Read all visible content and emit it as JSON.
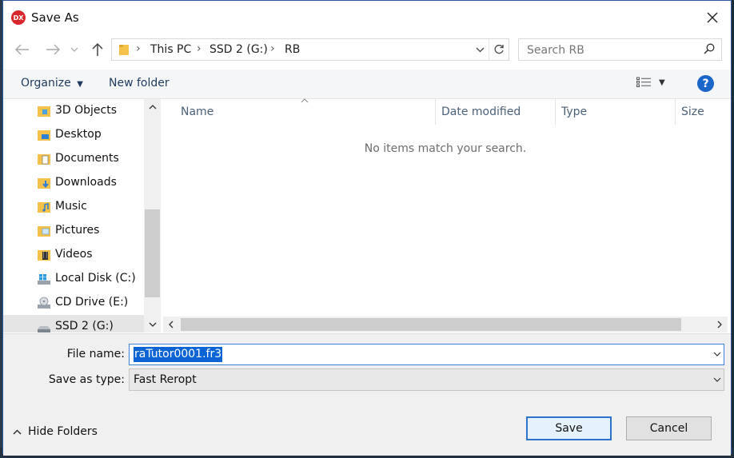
{
  "window": {
    "title": "Save As",
    "app_icon_text": "DX"
  },
  "address": {
    "crumbs": [
      "This PC",
      "SSD 2 (G:)",
      "RB"
    ]
  },
  "search": {
    "placeholder": "Search RB"
  },
  "toolbar": {
    "organize_label": "Organize",
    "new_folder_label": "New folder",
    "help_label": "?"
  },
  "nav_items": [
    {
      "label": "3D Objects",
      "icon": "3d-objects-folder-icon"
    },
    {
      "label": "Desktop",
      "icon": "desktop-folder-icon"
    },
    {
      "label": "Documents",
      "icon": "documents-folder-icon"
    },
    {
      "label": "Downloads",
      "icon": "downloads-folder-icon"
    },
    {
      "label": "Music",
      "icon": "music-folder-icon"
    },
    {
      "label": "Pictures",
      "icon": "pictures-folder-icon"
    },
    {
      "label": "Videos",
      "icon": "videos-folder-icon"
    },
    {
      "label": "Local Disk (C:)",
      "icon": "windows-drive-icon"
    },
    {
      "label": "CD Drive (E:)",
      "icon": "cd-drive-icon"
    },
    {
      "label": "SSD 2 (G:)",
      "icon": "drive-icon",
      "selected": true
    }
  ],
  "file_list": {
    "columns": [
      "Name",
      "Date modified",
      "Type",
      "Size"
    ],
    "empty_message": "No items match your search."
  },
  "form": {
    "file_name_label": "File name:",
    "file_name_value": "raTutor0001.fr3",
    "save_type_label": "Save as type:",
    "save_type_value": "Fast Reropt"
  },
  "footer": {
    "hide_folders_label": "Hide Folders",
    "save_label": "Save",
    "cancel_label": "Cancel"
  },
  "colors": {
    "accent": "#0a64d6",
    "help": "#1b66c9",
    "app_icon": "#d8282e",
    "folder": "#f4c14b"
  }
}
